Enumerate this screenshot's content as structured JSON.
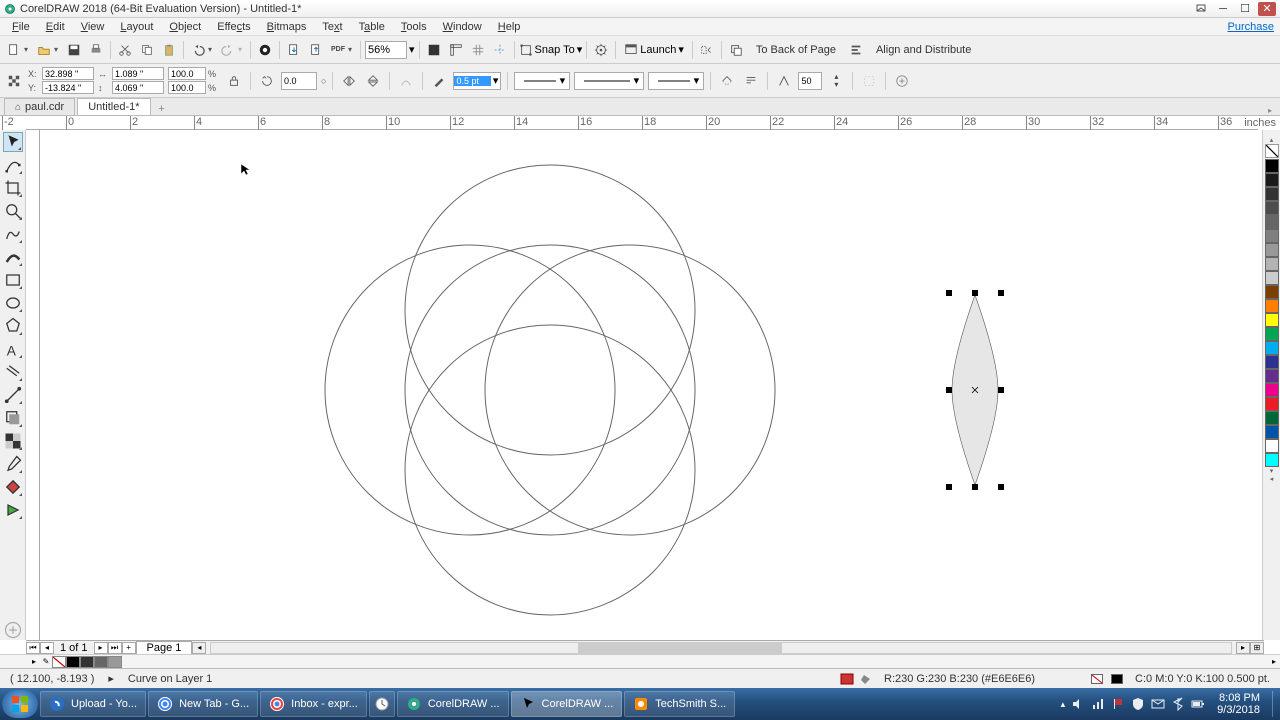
{
  "window": {
    "title": "CorelDRAW 2018 (64-Bit Evaluation Version) - Untitled-1*"
  },
  "menu": {
    "items": [
      "File",
      "Edit",
      "View",
      "Layout",
      "Object",
      "Effects",
      "Bitmaps",
      "Text",
      "Table",
      "Tools",
      "Window",
      "Help"
    ],
    "purchase": "Purchase"
  },
  "toolbar1": {
    "zoom": "56%",
    "snap": "Snap To",
    "launch": "Launch",
    "btn_back": "To Back of Page",
    "btn_align": "Align and Distribute"
  },
  "propbar": {
    "x": "32.898 \"",
    "y": "-13.824 \"",
    "w": "1.089 \"",
    "h": "4.069 \"",
    "sx": "100.0",
    "sy": "100.0",
    "rot": "0.0",
    "outline_width": "0.5 pt",
    "stepq": "50"
  },
  "doctabs": {
    "tab0": "paul.cdr",
    "tab1": "Untitled-1*"
  },
  "ruler": {
    "units": "inches"
  },
  "pagebar": {
    "pageno": "1  of  1",
    "tab": "Page 1"
  },
  "status": {
    "coords": "( 12.100, -8.193 )",
    "selection": "Curve on Layer 1",
    "color": "R:230 G:230 B:230 (#E6E6E6)",
    "fillinfo": "C:0 M:0 Y:0 K:100 0.500 pt."
  },
  "taskbar": {
    "items": [
      "Upload - Yo...",
      "New Tab - G...",
      "Inbox - expr...",
      "",
      "CorelDRAW ...",
      "CorelDRAW ...",
      "TechSmith S..."
    ],
    "time": "8:08 PM",
    "date": "9/3/2018"
  },
  "palette": [
    "#000000",
    "#1a1a1a",
    "#333333",
    "#4d4d4d",
    "#666666",
    "#808080",
    "#999999",
    "#b3b3b3",
    "#cccccc",
    "#7b3f00",
    "#ff8000",
    "#ffff00",
    "#00a651",
    "#00aeef",
    "#2e3192",
    "#662d91",
    "#ec008c",
    "#ed1c24",
    "#006838",
    "#0054a6",
    "#ffffff",
    "#00ffff"
  ],
  "bottomswatches": [
    "#000000",
    "#333333",
    "#666666",
    "#999999"
  ]
}
